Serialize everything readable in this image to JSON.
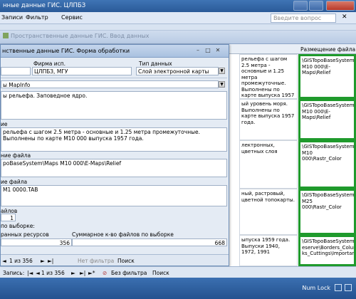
{
  "window": {
    "title": "нные данные ГИС. ЦЛПБЗ"
  },
  "menu": {
    "items": [
      "Записи",
      "Фильтр",
      "Сервис"
    ],
    "ask_placeholder": "Введите вопрос"
  },
  "background_window": {
    "title": "Пространственные данные ГИС. Ввод данных"
  },
  "sheet": {
    "header": "Размещение файла",
    "rows": [
      {
        "a": "рельефа с шагом 2.5 метра - основные и 1.25 метра промежуточные. Выполнены по карте выпуска 1957 года.",
        "b": "\\GISTopoBaseSystem\\ M10 000\\E-Maps\\Relief"
      },
      {
        "a": "ый уровень моря. Выполнены по карте выпуска 1957 года.",
        "b": "\\GISTopoBaseSystem\\ M10 000\\E-Maps\\Relief"
      },
      {
        "a": "лектронных, цветных слоя",
        "b": "\\GISTopoBaseSystem\\ M10 000\\Rastr_Color"
      },
      {
        "a": "ный, растровый, цветной топокарты.",
        "b": "\\GISTopoBaseSystem\\ M25 000\\Rastr_Color"
      },
      {
        "a": "ыпуска 1959 года. Выпуски 1940, 1972, 1991",
        "b": "\\GISTopoBaseSystem\\ eserve\\Borders_Columns\\ ks_Cuttings\\Important_n"
      }
    ]
  },
  "dialog": {
    "title": "нственные данные ГИС. Форма обработки",
    "labels": {
      "firm": "Фирма исп.",
      "type": "Тип данных",
      "format": "ы MapInfo",
      "section2": "ие",
      "path": "ние файла",
      "filename": "ие файла",
      "files": "айлов",
      "by_selection": "по выборке:",
      "resources": "ранных ресурсов",
      "total": "Суммарное к-во файлов по выборке"
    },
    "values": {
      "firm": "ЦЛПБЗ, МГУ",
      "type": "Слой электронной карты",
      "desc1": "ы рельефа. Заповедное ядро.",
      "desc2": "рельефа с шагом 2.5 метра - основные и 1.25 метра промежуточные. Выполнены по карте М10 000 выпуска 1957 года.",
      "path": "pоBaseSystem\\Maps M10 000\\E-Maps\\Relief",
      "filename": "M1 0000.TAB",
      "files_count": "1",
      "resources_count": "356",
      "total_count": "668"
    },
    "nav": {
      "record": "1 из 356",
      "filter": "Нет фильтра",
      "search": "Поиск"
    }
  },
  "record_nav": {
    "label": "Запись:",
    "record": "1 из 356",
    "filter": "Без фильтра",
    "search": "Поиск"
  },
  "status": {
    "numlock": "Num Lock"
  }
}
